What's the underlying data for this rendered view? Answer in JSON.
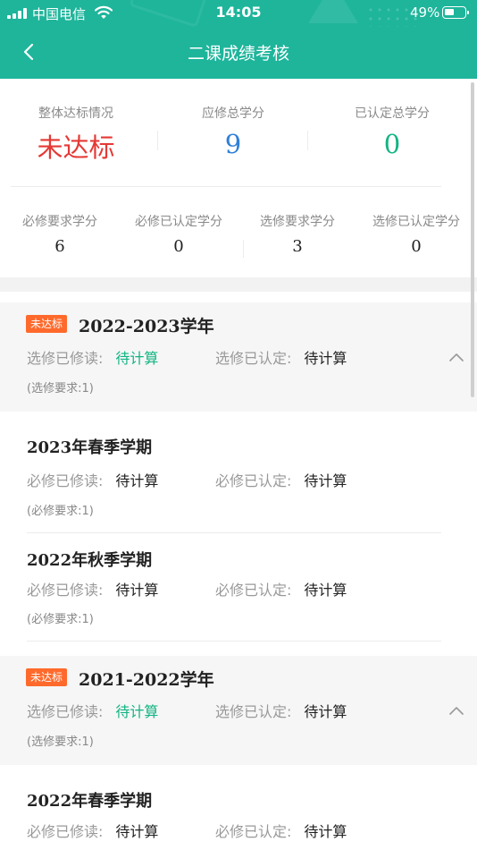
{
  "status_bar": {
    "carrier": "中国电信",
    "time": "14:05",
    "battery": "49%"
  },
  "header": {
    "title": "二课成绩考核"
  },
  "summary": {
    "overall_label": "整体达标情况",
    "overall_value": "未达标",
    "required_total_label": "应修总学分",
    "required_total_value": "9",
    "certified_total_label": "已认定总学分",
    "certified_total_value": "0",
    "mandatory_req_label": "必修要求学分",
    "mandatory_req_value": "6",
    "mandatory_cert_label": "必修已认定学分",
    "mandatory_cert_value": "0",
    "elective_req_label": "选修要求学分",
    "elective_req_value": "3",
    "elective_cert_label": "选修已认定学分",
    "elective_cert_value": "0"
  },
  "years": [
    {
      "badge": "未达标",
      "title": "2022-2023学年",
      "taken_label": "选修已修读:",
      "taken_value": "待计算",
      "cert_label": "选修已认定:",
      "cert_value": "待计算",
      "requirement": "(选修要求:1)",
      "terms": [
        {
          "title": "2023年春季学期",
          "taken_label": "必修已修读:",
          "taken_value": "待计算",
          "cert_label": "必修已认定:",
          "cert_value": "待计算",
          "requirement": "(必修要求:1)"
        },
        {
          "title": "2022年秋季学期",
          "taken_label": "必修已修读:",
          "taken_value": "待计算",
          "cert_label": "必修已认定:",
          "cert_value": "待计算",
          "requirement": "(必修要求:1)"
        }
      ]
    },
    {
      "badge": "未达标",
      "title": "2021-2022学年",
      "taken_label": "选修已修读:",
      "taken_value": "待计算",
      "cert_label": "选修已认定:",
      "cert_value": "待计算",
      "requirement": "(选修要求:1)",
      "terms": [
        {
          "title": "2022年春季学期",
          "taken_label": "必修已修读:",
          "taken_value": "待计算",
          "cert_label": "必修已认定:",
          "cert_value": "待计算"
        }
      ]
    }
  ],
  "colors": {
    "header": "#1eb59b",
    "fail": "#e53935",
    "blue": "#2f7fd8",
    "green": "#12b483",
    "badge": "#ff6a2c"
  }
}
